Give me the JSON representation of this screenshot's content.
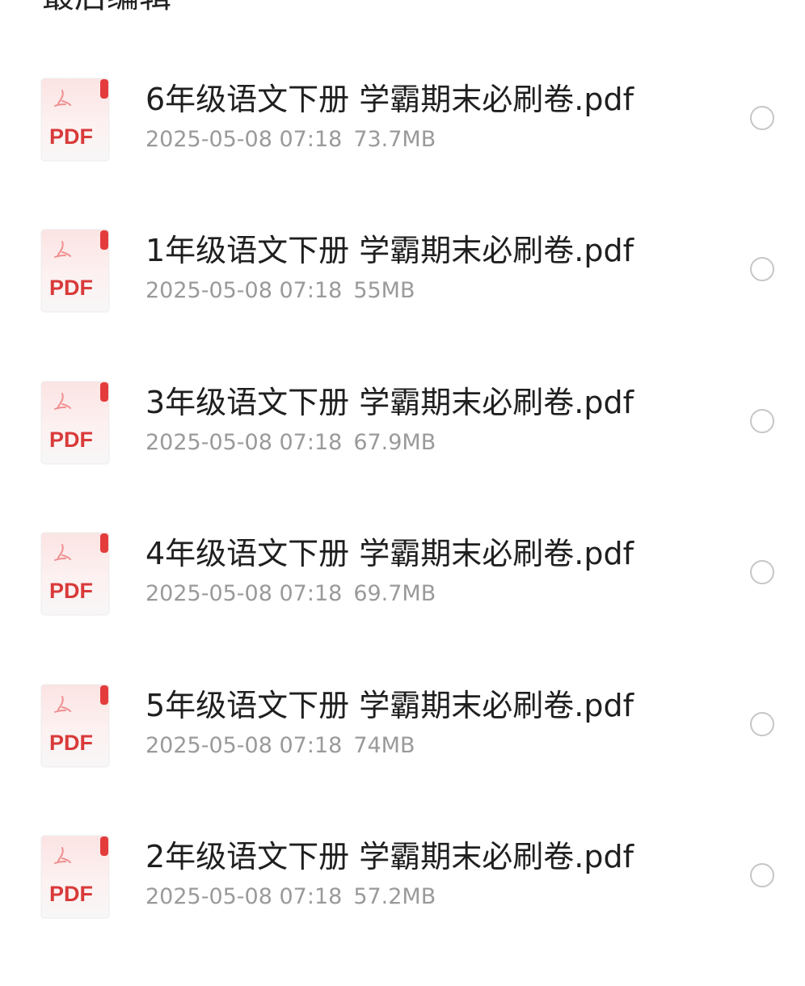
{
  "header": {
    "title": "最后编辑",
    "view_toggle_icon": "grid-view-icon"
  },
  "file_icon": {
    "label": "PDF",
    "icon": "pdf-file-icon",
    "accent_color": "#d93a3a"
  },
  "files": [
    {
      "name": "6年级语文下册 学霸期末必刷卷.pdf",
      "date": "2025-05-08 07:18",
      "size": "73.7MB"
    },
    {
      "name": "1年级语文下册 学霸期末必刷卷.pdf",
      "date": "2025-05-08 07:18",
      "size": "55MB"
    },
    {
      "name": "3年级语文下册 学霸期末必刷卷.pdf",
      "date": "2025-05-08 07:18",
      "size": "67.9MB"
    },
    {
      "name": "4年级语文下册 学霸期末必刷卷.pdf",
      "date": "2025-05-08 07:18",
      "size": "69.7MB"
    },
    {
      "name": "5年级语文下册 学霸期末必刷卷.pdf",
      "date": "2025-05-08 07:18",
      "size": "74MB"
    },
    {
      "name": "2年级语文下册 学霸期末必刷卷.pdf",
      "date": "2025-05-08 07:18",
      "size": "57.2MB"
    }
  ]
}
